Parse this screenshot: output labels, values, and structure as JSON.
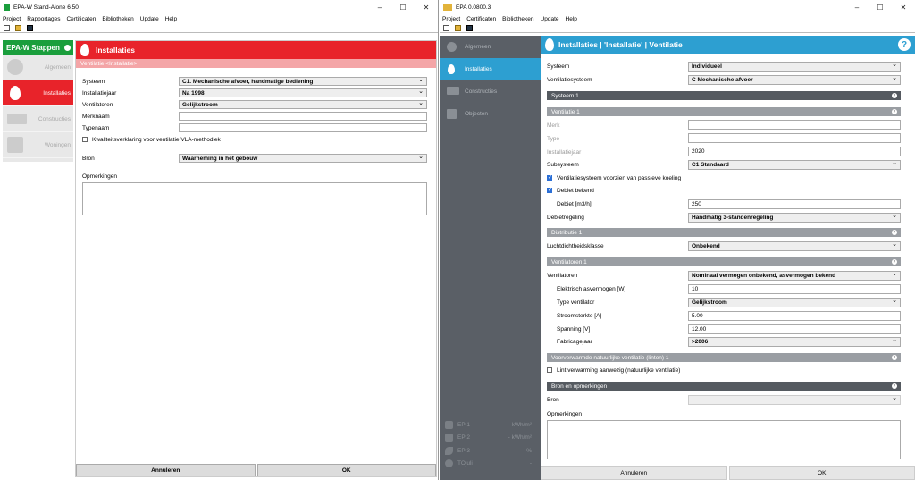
{
  "winA": {
    "title": "EPA-W Stand-Alone 6.50",
    "menu": [
      "Project",
      "Rapportages",
      "Certificaten",
      "Bibliotheken",
      "Update",
      "Help"
    ],
    "steps_title": "EPA-W Stappen",
    "steps": [
      "Algemeen",
      "Installaties",
      "Constructies",
      "Woningen"
    ],
    "header": "Installaties",
    "subheader": "Ventilatie <Installatie>",
    "labels": {
      "systeem": "Systeem",
      "installatiejaar": "Installatiejaar",
      "ventilatoren": "Ventilatoren",
      "merknaam": "Merknaam",
      "typenaam": "Typenaam",
      "kwaliteit": "Kwaliteitsverklaring voor ventilatie VLA-methodiek",
      "bron": "Bron",
      "opmerkingen": "Opmerkingen"
    },
    "values": {
      "systeem": "C1. Mechanische afvoer, handmatige bediening",
      "installatiejaar": "Na 1998",
      "ventilatoren": "Gelijkstroom",
      "merknaam": "",
      "typenaam": "",
      "bron": "Waarneming in het gebouw"
    },
    "buttons": {
      "cancel": "Annuleren",
      "ok": "OK"
    }
  },
  "winB": {
    "title": "EPA 0.0800.3",
    "menu": [
      "Project",
      "Certificaten",
      "Bibliotheken",
      "Update",
      "Help"
    ],
    "sidebar": [
      "Algemeen",
      "Installaties",
      "Constructies",
      "Objecten"
    ],
    "ep": [
      {
        "label": "EP 1",
        "value": "- kWh/m²"
      },
      {
        "label": "EP 2",
        "value": "- kWh/m²"
      },
      {
        "label": "EP 3",
        "value": "- %"
      },
      {
        "label": "TOjuli",
        "value": "-"
      }
    ],
    "header": "Installaties | 'Installatie' | Ventilatie",
    "labels": {
      "systeem": "Systeem",
      "ventilatiesysteem": "Ventilatiesysteem",
      "merk": "Merk",
      "type": "Type",
      "installatiejaar": "Installatiejaar",
      "subsysteem": "Subsysteem",
      "passieve": "Ventilatiesysteem voorzien van passieve koeling",
      "debiet_bekend": "Debiet bekend",
      "debiet": "Debiet [m3/h]",
      "debietregeling": "Debietregeling",
      "luchtdicht": "Luchtdichtheidsklasse",
      "ventilatoren": "Ventilatoren",
      "elektrisch": "Elektrisch asvermogen [W]",
      "type_vent": "Type ventilator",
      "stroom": "Stroomsterkte [A]",
      "spanning": "Spanning [V]",
      "fabricage": "Fabricagejaar",
      "lint": "Lint verwarming aanwezig (natuurlijke ventilatie)",
      "bron": "Bron",
      "opmerkingen": "Opmerkingen"
    },
    "sections": {
      "systeem1": "Systeem 1",
      "ventilatie1": "Ventilatie 1",
      "distributie1": "Distributie 1",
      "ventilatoren1": "Ventilatoren 1",
      "voorverwarmde": "Voorverwarmde natuurlijke ventilatie (linten) 1",
      "bron_opm": "Bron en opmerkingen"
    },
    "values": {
      "systeem": "Individueel",
      "ventilatiesysteem": "C Mechanische afvoer",
      "merk": "",
      "type": "",
      "installatiejaar": "2020",
      "subsysteem": "C1 Standaard",
      "debiet": "250",
      "debietregeling": "Handmatig 3-standenregeling",
      "luchtdicht": "Onbekend",
      "ventilatoren": "Nominaal vermogen onbekend, asvermogen bekend",
      "elektrisch": "10",
      "type_vent": "Gelijkstroom",
      "stroom": "5.00",
      "spanning": "12.00",
      "fabricage": ">2006",
      "bron": ""
    },
    "buttons": {
      "cancel": "Annuleren",
      "ok": "OK"
    }
  }
}
